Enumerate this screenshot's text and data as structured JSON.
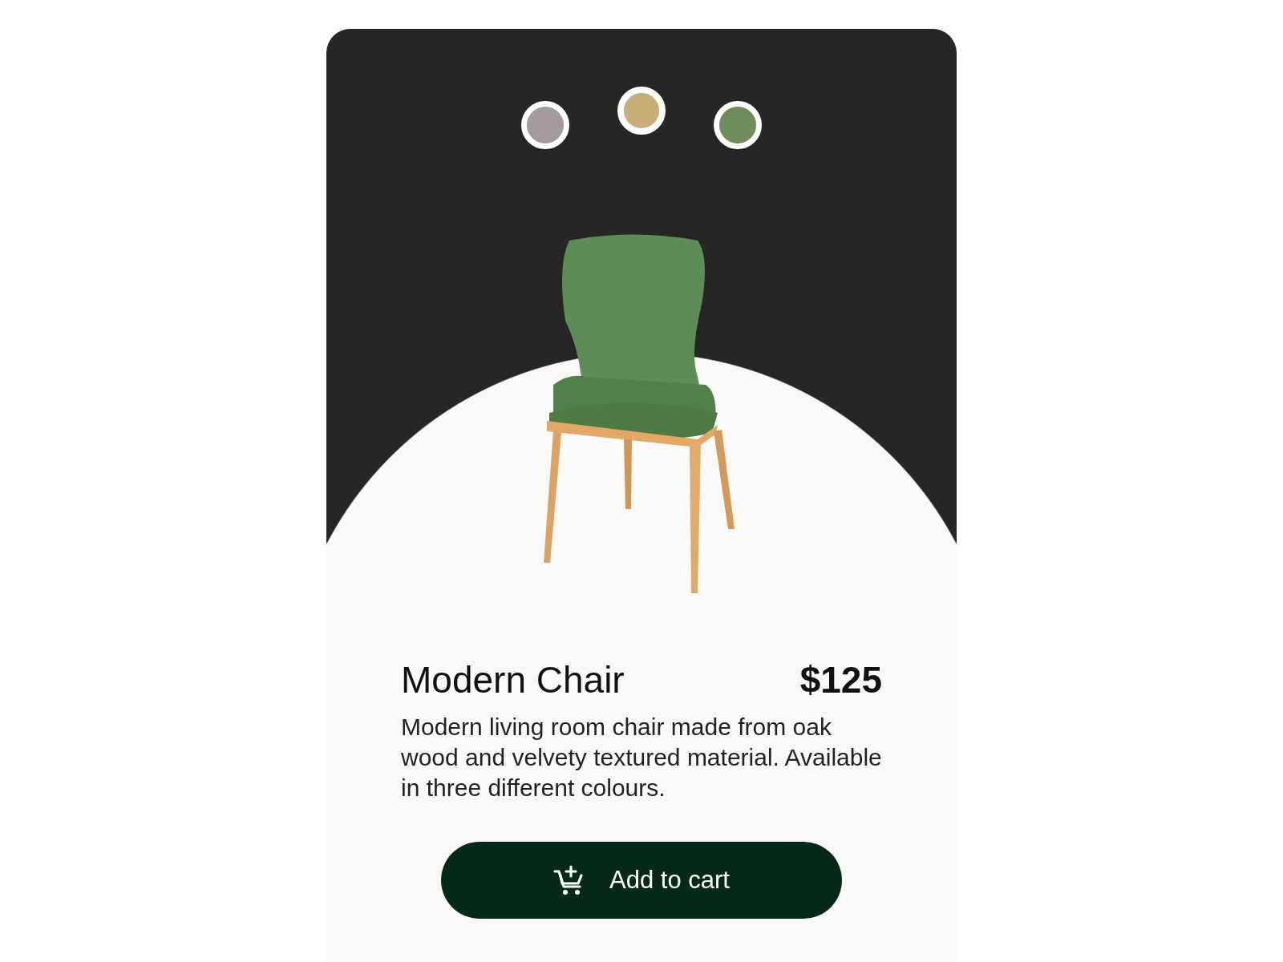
{
  "swatches": [
    {
      "color": "#a39b9c",
      "selected": false
    },
    {
      "color": "#c9ad78",
      "selected": true
    },
    {
      "color": "#6e8c5c",
      "selected": false
    }
  ],
  "product": {
    "name": "Modern Chair",
    "price": "$125",
    "description": "Modern living room chair made from oak wood and velvety textured material. Available in three different colours."
  },
  "button": {
    "label": "Add to cart"
  }
}
